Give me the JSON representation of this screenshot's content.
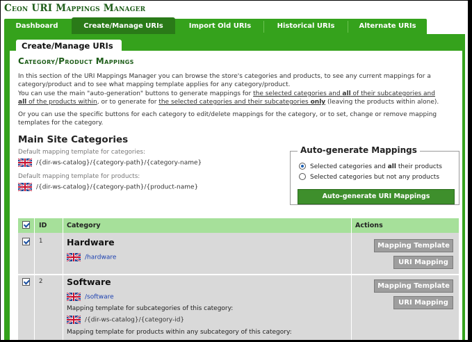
{
  "app": {
    "title": "Ceon URI Mappings Manager"
  },
  "tabs": [
    {
      "label": "Dashboard"
    },
    {
      "label": "Create/Manage URIs"
    },
    {
      "label": "Import Old URIs"
    },
    {
      "label": "Historical URIs"
    },
    {
      "label": "Alternate URIs"
    }
  ],
  "subtab": {
    "label": "Create/Manage URIs"
  },
  "section": {
    "title": "Category/Product Mappings",
    "intro1": "In this section of the URI Mappings Manager you can browse the store's categories and products, to see any current mappings for a category/product and to see what mapping template applies for any category/product.",
    "intro2a": "You can use the main \"auto-generation\" buttons to generate mappings for ",
    "intro2b": "the selected categories and ",
    "intro2c": "all",
    "intro2d": " of their subcategories and",
    "intro2e": "all",
    "intro2f": " of the products within",
    "intro2g": ", or to generate for ",
    "intro2h": "the selected categories and their subcategories ",
    "intro2i": "only",
    "intro2j": " (leaving the products within alone).",
    "intro3": "Or you can use the specific buttons for each category to edit/delete mappings for the category, or to set, change or remove mapping templates for the category."
  },
  "main_categories": {
    "heading": "Main Site Categories",
    "cat_template_label": "Default mapping template for categories:",
    "cat_template": "/{dir-ws-catalog}/{category-path}/{category-name}",
    "prod_template_label": "Default mapping template for products:",
    "prod_template": "/{dir-ws-catalog}/{category-path}/{product-name}"
  },
  "autogen": {
    "legend": "Auto-generate Mappings",
    "option1_a": "Selected categories and ",
    "option1_b": "all",
    "option1_c": " their products",
    "option2": "Selected categories but not any products",
    "selected_option": 1,
    "button": "Auto-generate URI Mappings"
  },
  "table": {
    "headers": {
      "id": "ID",
      "category": "Category",
      "actions": "Actions"
    },
    "rows": [
      {
        "id": "1",
        "name": "Hardware",
        "uri": "/hardware",
        "btn_template": "Mapping Template",
        "btn_uri": "URI Mapping"
      },
      {
        "id": "2",
        "name": "Software",
        "uri": "/software",
        "sub_label": "Mapping template for subcategories of this category:",
        "sub_template": "/{dir-ws-catalog}/{category-id}",
        "prod_label": "Mapping template for products within any subcategory of this category:",
        "btn_template": "Mapping Template",
        "btn_uri": "URI Mapping"
      }
    ]
  },
  "colors": {
    "brand_green": "#35a21c",
    "title_green": "#1e5d19",
    "header_row": "#a6e09a",
    "button_gray": "#9e9e9e"
  },
  "icons": {
    "flag": "uk-flag-icon",
    "checkbox": "checkbox-checked-icon"
  }
}
